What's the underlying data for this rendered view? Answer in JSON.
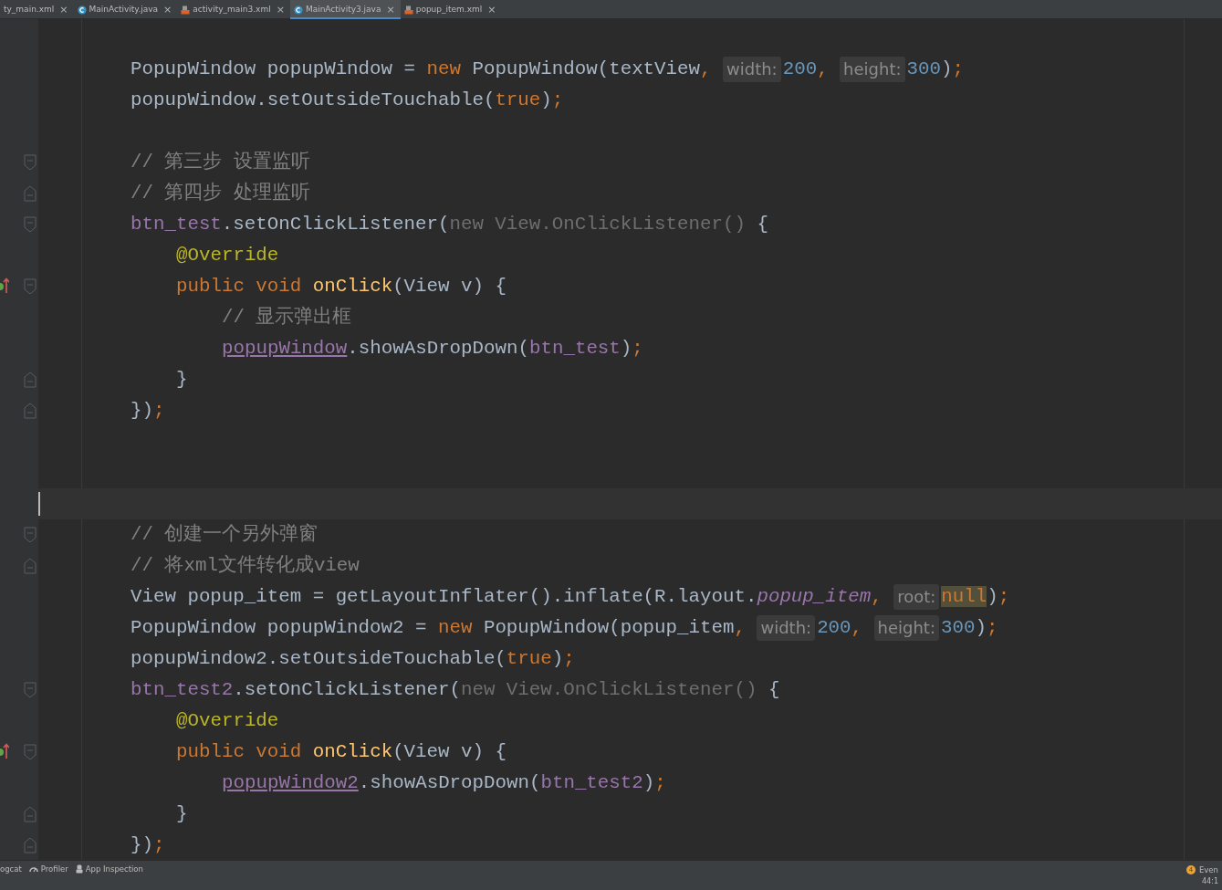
{
  "tabs": [
    {
      "label": "ty_main.xml",
      "kind": "plain",
      "close": "×",
      "selected": false
    },
    {
      "label": "MainActivity.java",
      "kind": "java",
      "close": "×",
      "selected": false
    },
    {
      "label": "activity_main3.xml",
      "kind": "xml",
      "close": "×",
      "selected": false
    },
    {
      "label": "MainActivity3.java",
      "kind": "java",
      "close": "×",
      "selected": true
    },
    {
      "label": "popup_item.xml",
      "kind": "xml",
      "close": "×",
      "selected": false
    }
  ],
  "editor": {
    "lines": [
      {
        "kind": "blank"
      },
      {
        "tokens": [
          {
            "t": "PopupWindow popupWindow = ",
            "kind": "p"
          },
          {
            "t": "new",
            "kind": "k"
          },
          {
            "t": " PopupWindow(textView",
            "kind": "p"
          },
          {
            "t": ", ",
            "kind": "k"
          },
          {
            "t": "width:",
            "kind": "h"
          },
          {
            "t": "200",
            "kind": "n"
          },
          {
            "t": ", ",
            "kind": "k"
          },
          {
            "t": "height:",
            "kind": "h"
          },
          {
            "t": "300",
            "kind": "n"
          },
          {
            "t": ")",
            "kind": "p"
          },
          {
            "t": ";",
            "kind": "k"
          }
        ]
      },
      {
        "tokens": [
          {
            "t": "popupWindow.setOutsideTouchable(",
            "kind": "p"
          },
          {
            "t": "true",
            "kind": "k"
          },
          {
            "t": ")",
            "kind": "p"
          },
          {
            "t": ";",
            "kind": "k"
          }
        ]
      },
      {
        "kind": "blank"
      },
      {
        "kind": "fold_start",
        "tokens": [
          {
            "t": "// 第三步 设置监听",
            "kind": "c"
          }
        ]
      },
      {
        "kind": "fold_end",
        "tokens": [
          {
            "t": "// 第四步 处理监听",
            "kind": "c"
          }
        ]
      },
      {
        "kind": "fold_start",
        "tokens": [
          {
            "t": "btn_test",
            "kind": "f"
          },
          {
            "t": ".setOnClickListener(",
            "kind": "p"
          },
          {
            "t": "new View.OnClickListener() ",
            "kind": "g"
          },
          {
            "t": "{",
            "kind": "p"
          }
        ],
        "children": [
          {
            "tokens": [
              {
                "t": "@Override",
                "kind": "a"
              }
            ]
          },
          {
            "kind": "fold_start",
            "override": true,
            "tokens": [
              {
                "t": "public void ",
                "kind": "k"
              },
              {
                "t": "onClick",
                "kind": "m"
              },
              {
                "t": "(View v) {",
                "kind": "p"
              }
            ],
            "children": [
              {
                "tokens": [
                  {
                    "t": "// 显示弹出框",
                    "kind": "c"
                  }
                ]
              },
              {
                "tokens": [
                  {
                    "t": "popupWindow",
                    "kind": "fu"
                  },
                  {
                    "t": ".showAsDropDown(",
                    "kind": "p"
                  },
                  {
                    "t": "btn_test",
                    "kind": "f"
                  },
                  {
                    "t": ")",
                    "kind": "p"
                  },
                  {
                    "t": ";",
                    "kind": "k"
                  }
                ]
              }
            ]
          },
          {
            "kind": "fold_end",
            "tokens": [
              {
                "t": "}",
                "kind": "p"
              }
            ]
          }
        ]
      },
      {
        "kind": "fold_end",
        "tokens": [
          {
            "t": "})",
            "kind": "p"
          },
          {
            "t": ";",
            "kind": "k"
          }
        ]
      },
      {
        "kind": "blank"
      },
      {
        "kind": "blank"
      },
      {
        "kind": "blank",
        "current": true
      },
      {
        "kind": "fold_start",
        "tokens": [
          {
            "t": "// 创建一个另外弹窗",
            "kind": "c"
          }
        ]
      },
      {
        "kind": "fold_end",
        "tokens": [
          {
            "t": "// 将xml文件转化成view",
            "kind": "c"
          }
        ]
      },
      {
        "tokens": [
          {
            "t": "View popup_item = getLayoutInflater().inflate(R.layout.",
            "kind": "p"
          },
          {
            "t": "popup_item",
            "kind": "fi"
          },
          {
            "t": ", ",
            "kind": "k"
          },
          {
            "t": "root:",
            "kind": "h"
          },
          {
            "t": "null",
            "kind": "nh"
          },
          {
            "t": ")",
            "kind": "p"
          },
          {
            "t": ";",
            "kind": "k"
          }
        ]
      },
      {
        "tokens": [
          {
            "t": "PopupWindow popupWindow2 = ",
            "kind": "p"
          },
          {
            "t": "new",
            "kind": "k"
          },
          {
            "t": " PopupWindow(popup_item",
            "kind": "p"
          },
          {
            "t": ", ",
            "kind": "k"
          },
          {
            "t": "width:",
            "kind": "h"
          },
          {
            "t": "200",
            "kind": "n"
          },
          {
            "t": ", ",
            "kind": "k"
          },
          {
            "t": "height:",
            "kind": "h"
          },
          {
            "t": "300",
            "kind": "n"
          },
          {
            "t": ")",
            "kind": "p"
          },
          {
            "t": ";",
            "kind": "k"
          }
        ]
      },
      {
        "tokens": [
          {
            "t": "popupWindow2.setOutsideTouchable(",
            "kind": "p"
          },
          {
            "t": "true",
            "kind": "k"
          },
          {
            "t": ")",
            "kind": "p"
          },
          {
            "t": ";",
            "kind": "k"
          }
        ]
      },
      {
        "kind": "fold_start",
        "tokens": [
          {
            "t": "btn_test2",
            "kind": "f"
          },
          {
            "t": ".setOnClickListener(",
            "kind": "p"
          },
          {
            "t": "new View.OnClickListener() ",
            "kind": "g"
          },
          {
            "t": "{",
            "kind": "p"
          }
        ],
        "children": [
          {
            "tokens": [
              {
                "t": "@Override",
                "kind": "a"
              }
            ]
          },
          {
            "kind": "fold_start",
            "override": true,
            "tokens": [
              {
                "t": "public void ",
                "kind": "k"
              },
              {
                "t": "onClick",
                "kind": "m"
              },
              {
                "t": "(View v) {",
                "kind": "p"
              }
            ],
            "children": [
              {
                "tokens": [
                  {
                    "t": "popupWindow2",
                    "kind": "fu"
                  },
                  {
                    "t": ".showAsDropDown(",
                    "kind": "p"
                  },
                  {
                    "t": "btn_test2",
                    "kind": "f"
                  },
                  {
                    "t": ")",
                    "kind": "p"
                  },
                  {
                    "t": ";",
                    "kind": "k"
                  }
                ]
              }
            ]
          },
          {
            "kind": "fold_end",
            "tokens": [
              {
                "t": "}",
                "kind": "p"
              }
            ]
          }
        ]
      },
      {
        "kind": "fold_end",
        "tokens": [
          {
            "t": "})",
            "kind": "p"
          },
          {
            "t": ";",
            "kind": "k"
          }
        ]
      }
    ]
  },
  "status_bar": {
    "tools": [
      {
        "label": "ogcat",
        "kind": "plain"
      },
      {
        "label": "Profiler",
        "kind": "gauge"
      },
      {
        "label": "App Inspection",
        "kind": "inspect"
      }
    ],
    "event_count": "4",
    "event_label": "Even",
    "position": "44:1"
  }
}
